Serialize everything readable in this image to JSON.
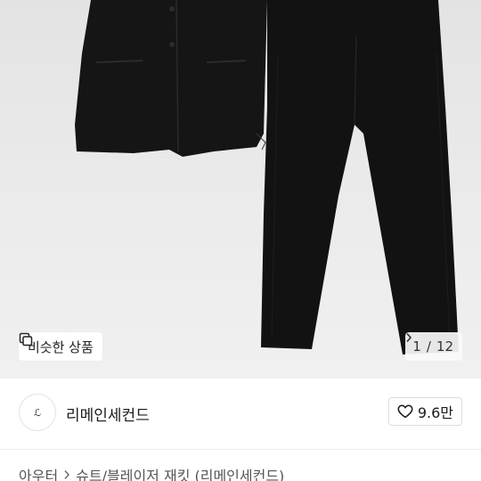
{
  "photo": {
    "similar_label": "비슷한 상품",
    "page_current": "1",
    "page_total": "12"
  },
  "seller": {
    "avatar_mark": "ℒ",
    "name": "리메인세컨드",
    "like_count": "9.6만"
  },
  "breadcrumb": {
    "category": "아우터",
    "product": "슈트/블레이저 재킷 (리메인세컨드)"
  },
  "colors": {
    "garment": "#141414",
    "background": "#e8e8e8"
  }
}
